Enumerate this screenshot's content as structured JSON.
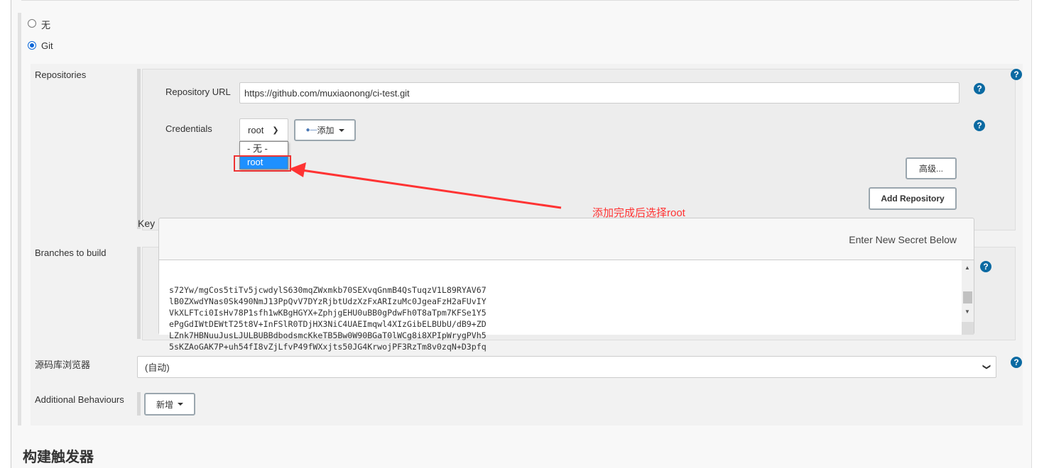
{
  "scm": {
    "options": [
      {
        "label": "无",
        "selected": false
      },
      {
        "label": "Git",
        "selected": true
      }
    ]
  },
  "repositories": {
    "label": "Repositories",
    "url_label": "Repository URL",
    "url_value": "https://github.com/muxiaonong/ci-test.git",
    "credentials_label": "Credentials",
    "credentials_selected": "root",
    "credentials_options": [
      "- 无 -",
      "root"
    ],
    "add_button": "添加",
    "advanced_button": "高级...",
    "add_repository_button": "Add Repository"
  },
  "annotation": {
    "text": "添加完成后选择root",
    "color": "#ff3333"
  },
  "key_popup": {
    "label": "Key",
    "header": "Enter New Secret Below",
    "lines": [
      "s72Yw/mgCos5tiTv5jcwdylS630mqZWxmkb70SEXvqGnmB4QsTuqzV1L89RYAV67",
      "lB0ZXwdYNas0Sk490NmJ13PpQvV7DYzRjbtUdzXzFxARIzuMc0JgeaFzH2aFUvIY",
      "VkXLFTci0IsHv78P1sfh1wKBgHGYX+ZphjgEHU0uBB0gPdwFh0T8aTpm7KFSe1Y5",
      "ePgGdIWtDEWtT25t8V+InFSlR0TDjHX3NiC4UAEImqwl4XIzGibELBUbU/dB9+ZD",
      "LZnk7HBNuuJusLJULBUBBdbodsmcKkeTB5Bw0W90BGaT0lWCg8i8XPIpWrygPVh5",
      "5sKZAoGAK7P+uh54fI8vZjLfvP49fWXxjts50JG4KrwojPF3RzTm8v0zqN+D3pfq"
    ]
  },
  "branches": {
    "label": "Branches to build"
  },
  "browser": {
    "label": "源码库浏览器",
    "value": "(自动)"
  },
  "behaviours": {
    "label": "Additional Behaviours",
    "button": "新增"
  },
  "next_section": {
    "title": "构建触发器"
  },
  "help_icon": "?",
  "colors": {
    "accent": "#0b6aa2",
    "highlight": "#1e90ff",
    "annotation": "#ff3333"
  }
}
